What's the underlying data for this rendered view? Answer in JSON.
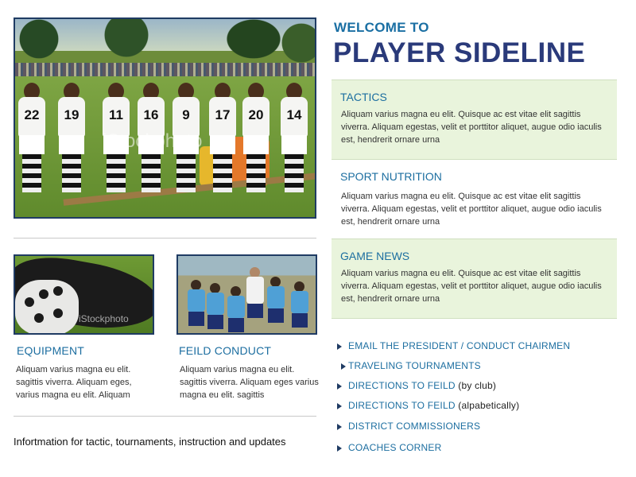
{
  "hero": {
    "jersey_numbers": [
      "22",
      "19",
      "11",
      "16",
      "9",
      "17",
      "20",
      "14"
    ],
    "watermark": "iStockphoto"
  },
  "header": {
    "welcome": "WELCOME TO",
    "title": "PLAYER SIDELINE"
  },
  "panels": [
    {
      "title": "TACTICS",
      "text": "Aliquam varius magna eu elit. Quisque ac est vitae elit sagittis viverra. Aliquam egestas, velit et porttitor aliquet, augue odio iaculis est, hendrerit ornare urna"
    },
    {
      "title": "SPORT NUTRITION",
      "text": "Aliquam varius magna eu elit. Quisque ac est vitae elit sagittis viverra. Aliquam egestas, velit et porttitor aliquet, augue odio iaculis est, hendrerit ornare urna"
    },
    {
      "title": "GAME NEWS",
      "text": "Aliquam varius magna eu elit. Quisque ac est vitae elit sagittis viverra. Aliquam egestas, velit et porttitor aliquet, augue odio iaculis est, hendrerit ornare urna"
    }
  ],
  "features": [
    {
      "title": "EQUIPMENT",
      "text": "Aliquam varius magna eu elit. sagittis viverra. Aliquam eges, varius magna eu elit. Aliquam",
      "watermark": "iStockphoto"
    },
    {
      "title": "FEILD CONDUCT",
      "text": "Aliquam varius magna eu elit. sagittis viverra. Aliquam eges varius magna eu elit. sagittis"
    }
  ],
  "links": [
    {
      "label": "EMAIL THE PRESIDENT / CONDUCT CHAIRMEN",
      "extra": ""
    },
    {
      "label": "TRAVELING TOURNAMENTS",
      "extra": ""
    },
    {
      "label": "DIRECTIONS TO FEILD",
      "extra": "(by club)"
    },
    {
      "label": "DIRECTIONS TO FEILD",
      "extra": "(alpabetically)"
    },
    {
      "label": "DISTRICT COMMISSIONERS",
      "extra": ""
    },
    {
      "label": "COACHES CORNER",
      "extra": ""
    }
  ],
  "footer": {
    "text": "Infortmation for tactic, tournaments, instruction and updates"
  },
  "colors": {
    "accent_blue": "#1c6ea0",
    "title_navy": "#2a3a7a",
    "panel_green": "#e9f4dc",
    "border_navy": "#1f3b63"
  }
}
